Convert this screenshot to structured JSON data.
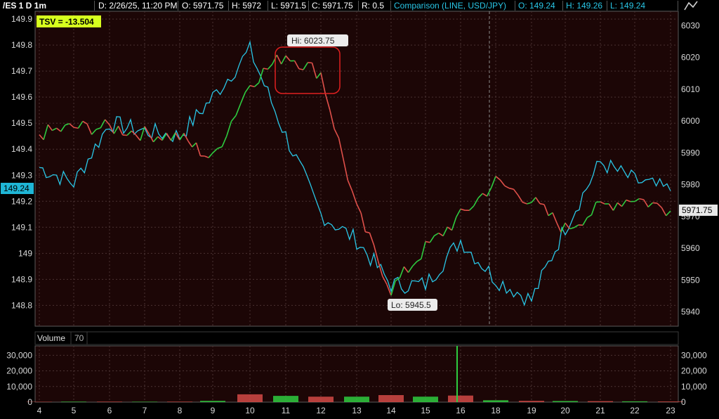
{
  "header": {
    "symbol": "/ES 1 D 1m",
    "date": "D: 2/26/25, 11:20 PM",
    "open": "O: 5971.75",
    "high": "H: 5972",
    "low": "L: 5971.5",
    "close": "C: 5971.75",
    "range": "R: 0.5",
    "comparison": "Comparison (LINE, USD/JPY)",
    "cmp_open": "O: 149.24",
    "cmp_high": "H: 149.26",
    "cmp_low": "L: 149.24"
  },
  "tsv_label": "TSV = -13.504",
  "hi_label": "Hi: 6023.75",
  "lo_label": "Lo: 5945.5",
  "usdjpy_badge": "149.24",
  "es_badge": "5971.75",
  "volume_label": "Volume",
  "volume_value": "70",
  "colors": {
    "background": "#1c0606",
    "usdjpy": "#29c6e6",
    "es_up": "#2ecc40",
    "es_down": "#e0504a",
    "highlight_box": "#e02020",
    "tsv_bg": "#d7ff1e"
  },
  "icons": [
    "chart-style-icon"
  ],
  "chart_data": [
    {
      "type": "line",
      "left_axis": {
        "label": "USD/JPY",
        "ticks": [
          "149.9",
          "149.8",
          "149.7",
          "149.6",
          "149.5",
          "149.4",
          "149.3",
          "149.2",
          "149.1",
          "149",
          "148.9",
          "148.8"
        ],
        "ylim": [
          148.72,
          149.93
        ]
      },
      "right_axis": {
        "label": "/ES",
        "ticks": [
          "6030",
          "6020",
          "6010",
          "6000",
          "5990",
          "5980",
          "5970",
          "5960",
          "5950",
          "5940"
        ],
        "ylim": [
          5935.5,
          6034.5
        ]
      },
      "x_ticks": [
        "4",
        "5",
        "6",
        "7",
        "8",
        "9",
        "10",
        "11",
        "12",
        "13",
        "14",
        "15",
        "16",
        "18",
        "19",
        "20",
        "21",
        "22",
        "23"
      ],
      "series": [
        {
          "name": "Comparison (LINE, USD/JPY)",
          "x": [
            "4",
            "5",
            "6",
            "7",
            "8",
            "9",
            "10",
            "11",
            "12",
            "13",
            "14",
            "15",
            "16",
            "18",
            "19",
            "20",
            "21",
            "22",
            "23"
          ],
          "values": [
            149.33,
            149.27,
            149.5,
            149.47,
            149.45,
            149.6,
            149.78,
            149.45,
            149.15,
            149.05,
            148.88,
            148.88,
            149.05,
            148.9,
            148.82,
            149.1,
            149.35,
            149.28,
            149.24
          ]
        },
        {
          "name": "/ES",
          "x": [
            "4",
            "5",
            "6",
            "7",
            "8",
            "9",
            "10",
            "11",
            "12",
            "13",
            "14",
            "15",
            "16",
            "18",
            "19",
            "20",
            "21",
            "22",
            "23"
          ],
          "values": [
            5996,
            5998,
            5998,
            5996,
            5995,
            5988,
            6012,
            6021,
            6015,
            5972,
            5947,
            5960,
            5970,
            5981,
            5975,
            5966,
            5973,
            5976,
            5971.75
          ]
        }
      ]
    },
    {
      "type": "bar",
      "title": "Volume",
      "ticks": [
        "30,000",
        "20,000",
        "10,000",
        "0"
      ],
      "ylim": [
        0,
        36000
      ],
      "x_ticks": [
        "4",
        "5",
        "6",
        "7",
        "8",
        "9",
        "10",
        "11",
        "12",
        "13",
        "14",
        "15",
        "16",
        "18",
        "19",
        "20",
        "21",
        "22",
        "23"
      ],
      "values": [
        200,
        300,
        300,
        250,
        300,
        800,
        5000,
        4000,
        3500,
        3500,
        4500,
        3500,
        4200,
        1200,
        800,
        700,
        600,
        500,
        400
      ],
      "spike": {
        "x": "16",
        "value": 36000
      }
    }
  ]
}
